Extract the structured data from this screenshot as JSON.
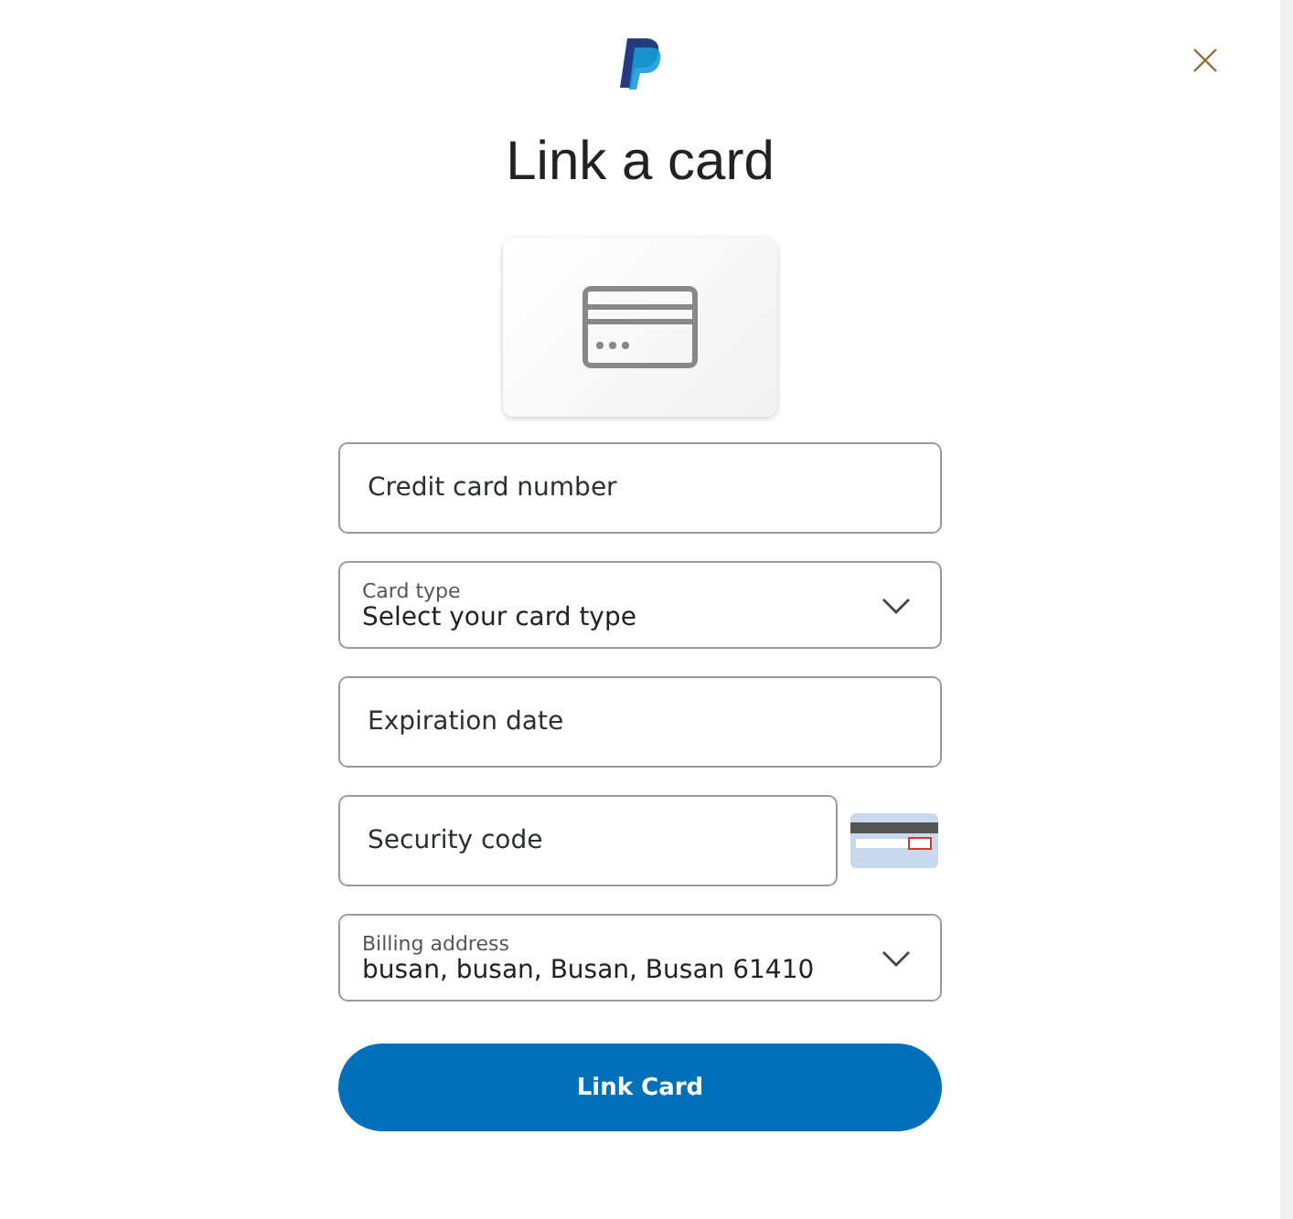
{
  "title": "Link a card",
  "fields": [
    {
      "kind": "input",
      "placeholder": "Credit card number"
    },
    {
      "kind": "select",
      "label": "Card type",
      "value": "Select your card type"
    },
    {
      "kind": "input",
      "placeholder": "Expiration date"
    },
    {
      "kind": "security",
      "placeholder": "Security code"
    },
    {
      "kind": "select",
      "label": "Billing address",
      "value": "busan, busan, Busan, Busan 61410"
    }
  ],
  "submit": "Link Card"
}
